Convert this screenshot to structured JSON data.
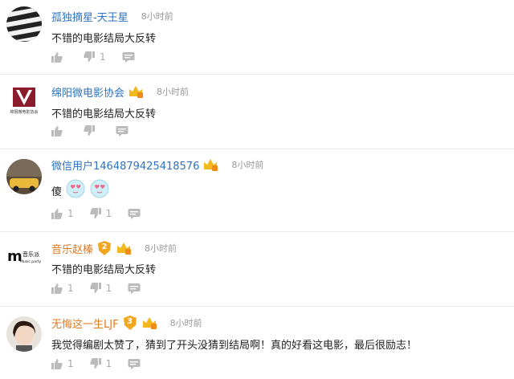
{
  "comments": [
    {
      "username": "孤独摘星-天王星",
      "time": "8小时前",
      "text": "不错的电影结局大反转",
      "likes": "",
      "dislikes": "1"
    },
    {
      "username": "绵阳微电影协会",
      "time": "8小时前",
      "text": "不错的电影结局大反转",
      "likes": "",
      "dislikes": "",
      "avatar_text": "绵阳微电影协会"
    },
    {
      "username": "微信用户1464879425418576",
      "time": "8小时前",
      "text": "傻",
      "likes": "1",
      "dislikes": "1"
    },
    {
      "username": "音乐赵榛",
      "time": "8小时前",
      "text": "不错的电影结局大反转",
      "likes": "1",
      "dislikes": "1",
      "level": "2",
      "avatar_text": "音乐派",
      "avatar_sub": "Music party"
    },
    {
      "username": "无悔这一生LJF",
      "time": "8小时前",
      "text": "我觉得编剧太赞了，猜到了开头没猜到结局啊！真的好看这电影，最后很励志！",
      "likes": "1",
      "dislikes": "1",
      "level": "3"
    }
  ],
  "colors": {
    "name_blue": "#2d73c4",
    "name_orange": "#e07a1e",
    "time": "#999999",
    "icon": "#bbbbbb"
  }
}
